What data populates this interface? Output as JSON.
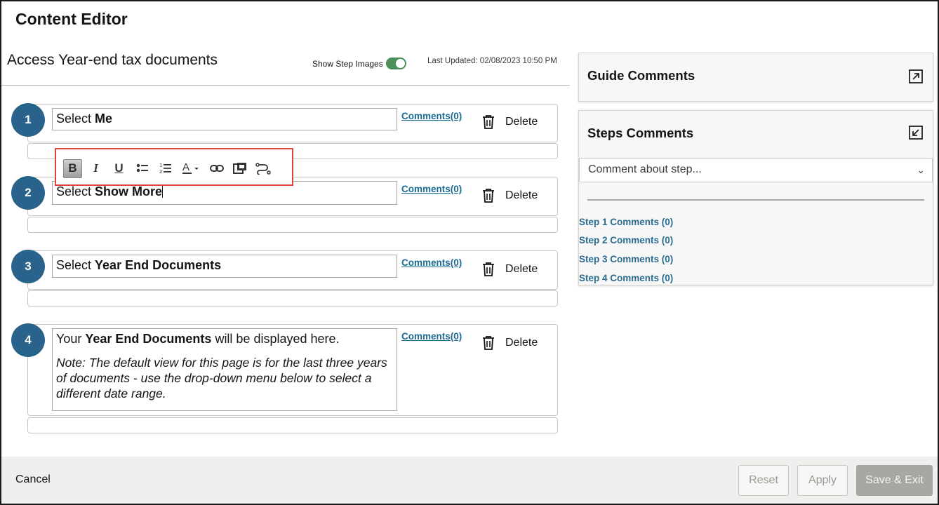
{
  "app": {
    "title": "Content Editor"
  },
  "guide": {
    "title": "Access Year-end tax documents",
    "show_images_label": "Show Step Images",
    "last_updated": "Last Updated: 02/08/2023 10:50 PM"
  },
  "steps": [
    {
      "num": "1",
      "prefix": "Select ",
      "bold": "Me",
      "suffix": "",
      "comments": "Comments(0)",
      "delete": "Delete"
    },
    {
      "num": "2",
      "prefix": "Select ",
      "bold": "Show More",
      "suffix": "",
      "comments": "Comments(0)",
      "delete": "Delete"
    },
    {
      "num": "3",
      "prefix": "Select ",
      "bold": "Year End Documents",
      "suffix": "",
      "comments": "Comments(0)",
      "delete": "Delete"
    },
    {
      "num": "4",
      "prefix": "Your ",
      "bold": "Year End Documents",
      "suffix": " will be displayed here.",
      "note": "Note: The default view for this page is for the last three years of documents - use the drop-down menu below to select a different date range.",
      "comments": "Comments(0)",
      "delete": "Delete"
    }
  ],
  "toolbar": {
    "bold": "B",
    "italic": "I",
    "underline": "U",
    "icons": [
      "bold-icon",
      "italic-icon",
      "underline-icon",
      "bulleted-list-icon",
      "numbered-list-icon",
      "text-color-icon",
      "link-icon",
      "insert-media-icon",
      "branch-icon"
    ]
  },
  "panel": {
    "guide_comments_title": "Guide Comments",
    "steps_comments_title": "Steps Comments",
    "select_value": "Comment about step...",
    "step_links": [
      "Step 1 Comments (0)",
      "Step 2 Comments (0)",
      "Step 3 Comments (0)",
      "Step 4 Comments (0)"
    ]
  },
  "footer": {
    "cancel": "Cancel",
    "reset": "Reset",
    "apply": "Apply",
    "save_exit": "Save & Exit"
  },
  "colors": {
    "accent": "#29628a",
    "toggle_on": "#4c8f58",
    "highlight_border": "#d9453a",
    "link": "#1b6b93"
  }
}
